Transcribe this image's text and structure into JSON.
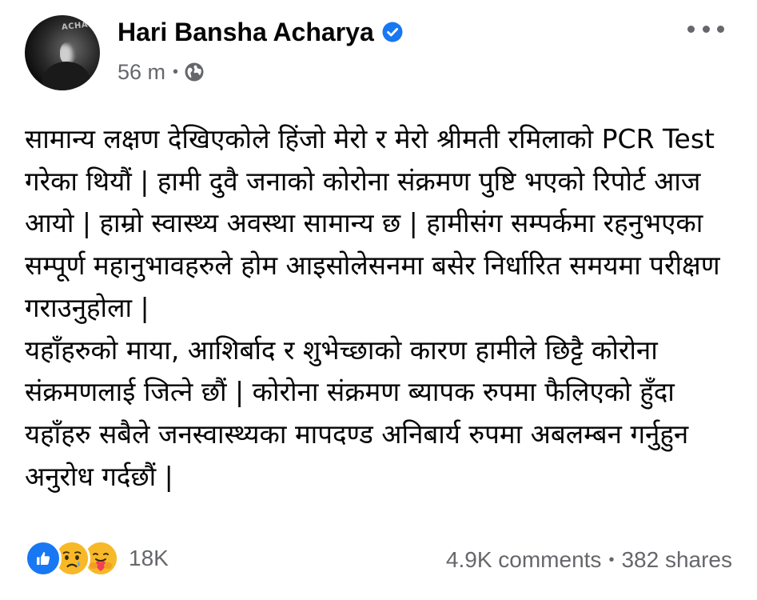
{
  "post": {
    "author": {
      "name": "Hari Bansha Acharya",
      "verified": true,
      "avatar_text": "ACHAR"
    },
    "timestamp": "56 m",
    "meta_separator": "•",
    "audience_icon": "globe-icon",
    "more_icon": "more-options-icon",
    "body_paragraphs": [
      "सामान्य लक्षण देखिएकोले हिंजो मेरो र मेरो श्रीमती रमिलाको PCR Test गरेका थियौं | हामी दुवै जनाको कोरोना संक्रमण पुष्टि भएको रिपोर्ट आज आयो | हाम्रो स्वास्थ्य अवस्था सामान्य छ | हामीसंग सम्पर्कमा रहनुभएका सम्पूर्ण महानुभावहरुले होम आइसोलेसनमा बसेर निर्धारित समयमा परीक्षण गराउनुहोला |",
      "यहाँहरुको माया, आशिर्बाद र शुभेच्छाको कारण हामीले छिट्टै कोरोना संक्रमणलाई जित्ने छौं | कोरोना संक्रमण ब्यापक रुपमा फैलिएको हुँदा यहाँहरु सबैले जनस्वास्थ्यका मापदण्ड अनिबार्य रुपमा अबलम्बन गर्नुहुन अनुरोध गर्दछौं |"
    ],
    "reactions": {
      "icons": [
        "like-icon",
        "sad-icon",
        "care-icon"
      ],
      "count": "18K"
    },
    "comments": "4.9K comments",
    "stats_separator": "•",
    "shares": "382 shares"
  },
  "colors": {
    "primary_text": "#050505",
    "secondary_text": "#65676b",
    "like_blue": "#1877f2",
    "reaction_yellow": "#f7b928",
    "verified_blue": "#1877f2"
  }
}
